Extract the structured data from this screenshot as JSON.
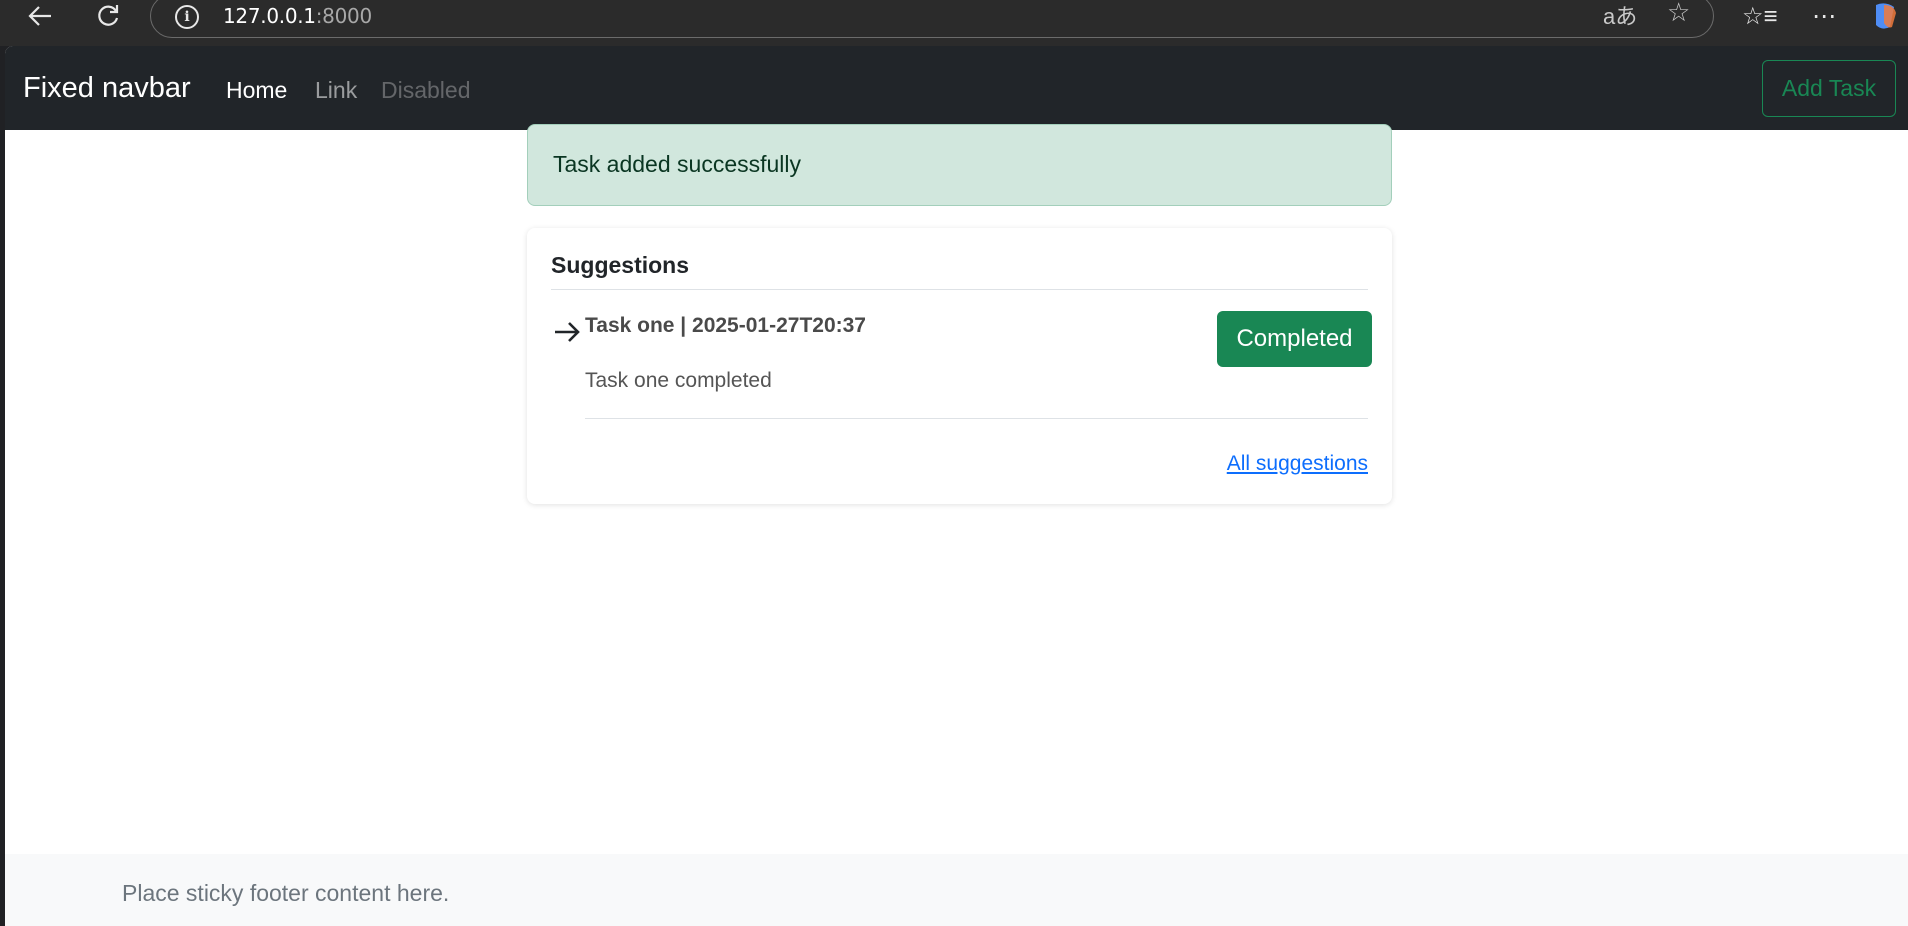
{
  "browser": {
    "url_host": "127.0.0.1",
    "url_port": ":8000",
    "back_icon": "back-arrow-icon",
    "reload_icon": "reload-icon",
    "info_glyph": "i",
    "translate_glyph": "aあ",
    "star_glyph": "☆",
    "favorites_glyph": "☆≡",
    "more_glyph": "⋯"
  },
  "navbar": {
    "brand": "Fixed navbar",
    "links": [
      "Home",
      "Link",
      "Disabled"
    ],
    "add_task_label": "Add Task"
  },
  "alert": {
    "message": "Task added successfully",
    "color": "#d1e7dd"
  },
  "suggestions": {
    "title": "Suggestions",
    "items": [
      {
        "title": "Task one | 2025-01-27T20:37",
        "description": "Task one completed",
        "status_label": "Completed"
      }
    ],
    "all_link": "All suggestions"
  },
  "footer": {
    "text": "Place sticky footer content here."
  },
  "colors": {
    "success": "#198754",
    "navbar_bg": "#212529",
    "link": "#0d6efd"
  }
}
